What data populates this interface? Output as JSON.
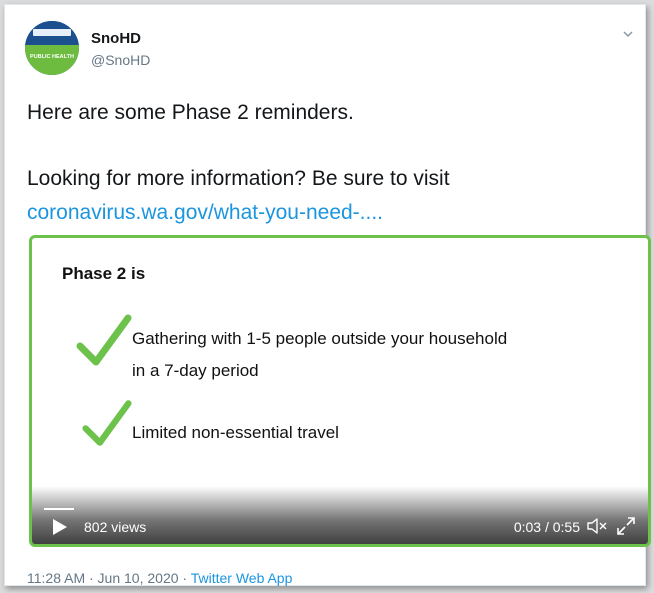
{
  "author": {
    "display_name": "SnoHD",
    "handle": "@SnoHD",
    "avatar_text": "PUBLIC HEALTH"
  },
  "tweet": {
    "line1": "Here are some Phase 2 reminders.",
    "line2": "Looking for more information? Be sure to visit",
    "link": "coronavirus.wa.gov/what-you-need-...."
  },
  "video": {
    "border_color": "#6cc24a",
    "slide_title": "Phase 2 is",
    "items": [
      {
        "line1": "Gathering with 1-5 people outside your household",
        "line2": "in a 7-day period"
      },
      {
        "line1": "Limited non-essential travel"
      }
    ],
    "views": "802 views",
    "time": "0:03 / 0:55",
    "progress_fraction": 0.05
  },
  "meta": {
    "timestamp": "11:28 AM · Jun 10, 2020 · ",
    "source": "Twitter Web App"
  },
  "colors": {
    "link": "#1b95e0",
    "check": "#6cc24a"
  }
}
